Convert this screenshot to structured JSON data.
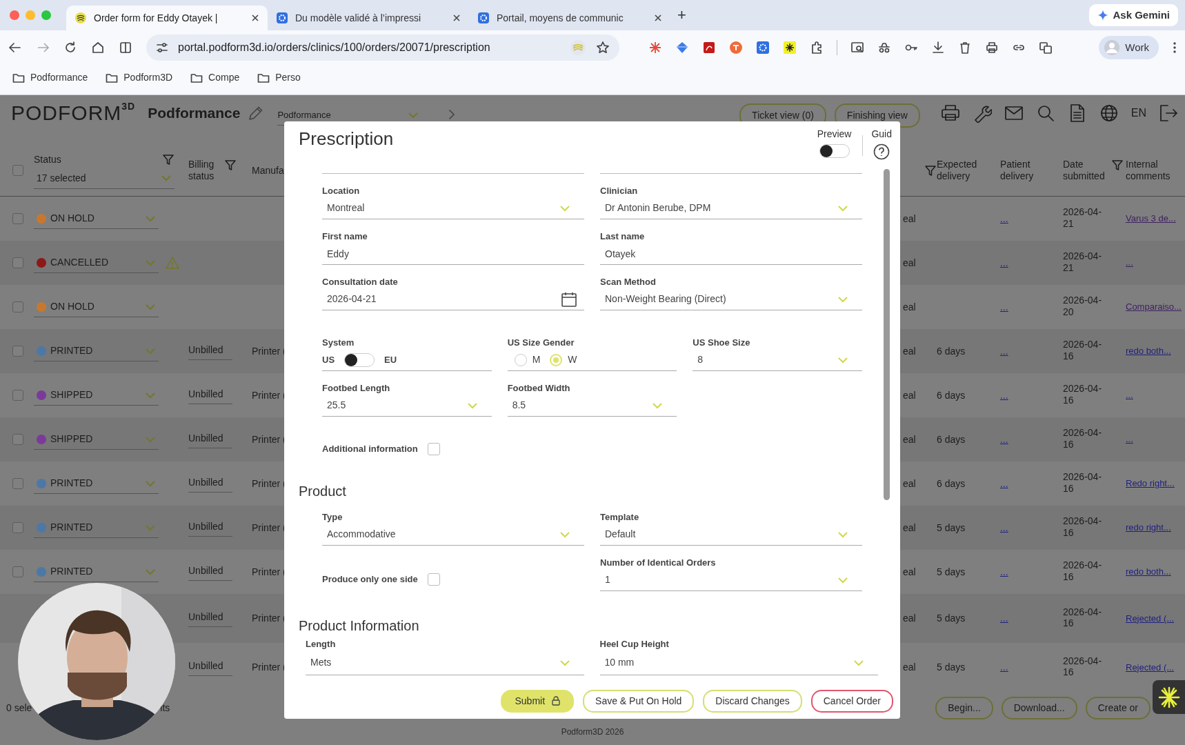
{
  "browser": {
    "tabs": [
      {
        "title": "Order form for Eddy Otayek |",
        "selected": true
      },
      {
        "title": "Du modèle validé à l’impressi",
        "selected": false
      },
      {
        "title": "Portail, moyens de communic",
        "selected": false
      }
    ],
    "new_tab": "+",
    "gemini": "Ask Gemini",
    "url": "portal.podform3d.io/orders/clinics/100/orders/20071/prescription",
    "profile": "Work",
    "bookmarks": [
      "Podformance",
      "Podform3D",
      "Compe",
      "Perso"
    ]
  },
  "app": {
    "logo": "PODFORM",
    "logo_sup": "3D",
    "clinic": "Podformance",
    "selector": "Podformance",
    "views": [
      "Ticket view (0)",
      "Finishing view"
    ],
    "language": "EN"
  },
  "table": {
    "all_checked": false,
    "status_filter": "17 selected",
    "columns": [
      {
        "label": "Status",
        "filter": true
      },
      {
        "label": "Billing status",
        "filter": true
      },
      {
        "label": "Manufa",
        "filter": false
      },
      {
        "filter": true
      },
      {
        "label": "Expected delivery",
        "filter": false
      },
      {
        "label": "Patient delivery",
        "filter": false
      },
      {
        "label": "Date submitted",
        "filter": true
      },
      {
        "label": "Internal comments",
        "filter": false
      }
    ],
    "rows": [
      {
        "checked": false,
        "status": "ON HOLD",
        "color": "#c8782e",
        "warning": false,
        "location": "eal",
        "patient": "...",
        "date": "2026-04-21",
        "comment": "Varus 3 de...",
        "visited": true
      },
      {
        "checked": false,
        "status": "CANCELLED",
        "color": "#8c1818",
        "warning": true,
        "location": "eal",
        "patient": "...",
        "date": "2026-04-21",
        "comment": "...",
        "visited": true
      },
      {
        "checked": false,
        "status": "ON HOLD",
        "color": "#c8782e",
        "warning": false,
        "location": "eal",
        "patient": "...",
        "date": "2026-04-20",
        "comment": "Comparaiso...",
        "visited": true
      },
      {
        "checked": false,
        "status": "PRINTED",
        "color": "#4b78a8",
        "warning": false,
        "billing": "Unbilled",
        "manufacturer": "Printer (",
        "location": "eal",
        "expected": "6 days",
        "patient": "...",
        "date": "2026-04-16",
        "comment": "redo both...",
        "visited": false
      },
      {
        "checked": false,
        "status": "SHIPPED",
        "color": "#7b3a9a",
        "warning": false,
        "billing": "Unbilled",
        "manufacturer": "Printer (",
        "location": "eal",
        "expected": "6 days",
        "patient": "...",
        "date": "2026-04-16",
        "comment": "...",
        "visited": false
      },
      {
        "checked": false,
        "status": "SHIPPED",
        "color": "#7b3a9a",
        "warning": false,
        "billing": "Unbilled",
        "manufacturer": "Printer (",
        "location": "eal",
        "expected": "6 days",
        "patient": "...",
        "date": "2026-04-16",
        "comment": "...",
        "visited": false
      },
      {
        "checked": false,
        "status": "PRINTED",
        "color": "#4b78a8",
        "warning": false,
        "billing": "Unbilled",
        "manufacturer": "Printer (",
        "location": "eal",
        "expected": "6 days",
        "patient": "...",
        "date": "2026-04-16",
        "comment": "Redo right...",
        "visited": false
      },
      {
        "checked": false,
        "status": "PRINTED",
        "color": "#4b78a8",
        "warning": false,
        "billing": "Unbilled",
        "manufacturer": "Printer (",
        "location": "eal",
        "expected": "5 days",
        "patient": "...",
        "date": "2026-04-16",
        "comment": "redo right...",
        "visited": false
      },
      {
        "checked": false,
        "status": "PRINTED",
        "color": "#4b78a8",
        "warning": false,
        "billing": "Unbilled",
        "manufacturer": "Printer (",
        "location": "eal",
        "expected": "5 days",
        "patient": "...",
        "date": "2026-04-16",
        "comment": "redo both...",
        "visited": false
      },
      {
        "billing": "Unbilled",
        "manufacturer": "Printer (",
        "location": "eal",
        "expected": "5 days",
        "patient": "...",
        "date": "2026-04-16",
        "comment": "Rejected (...",
        "visited": false
      },
      {
        "billing": "Unbilled",
        "manufacturer": "Printer (",
        "location": "eal",
        "expected": "5 days",
        "patient": "...",
        "date": "2026-04-16",
        "comment": "Rejected (...",
        "visited": false
      }
    ]
  },
  "footer": {
    "selection": "0 sele",
    "results": "lts",
    "actions": [
      "Begin...",
      "Download...",
      "Create or"
    ],
    "copyright": "Podform3D 2026"
  },
  "modal": {
    "title": "Prescription",
    "preview_label": "Preview",
    "preview_on": false,
    "guide_label": "Guid",
    "sections": [
      {
        "rows": [
          {
            "fields": [
              {
                "kind": "select",
                "label": "Location",
                "value": "Montreal"
              },
              {
                "kind": "select",
                "label": "Clinician",
                "value": "Dr Antonin Berube, DPM"
              }
            ]
          },
          {
            "fields": [
              {
                "kind": "text",
                "label": "First name",
                "value": "Eddy"
              },
              {
                "kind": "text",
                "label": "Last name",
                "value": "Otayek"
              }
            ]
          },
          {
            "fields": [
              {
                "kind": "date",
                "label": "Consultation date",
                "value": "2026-04-21"
              },
              {
                "kind": "select",
                "label": "Scan Method",
                "value": "Non-Weight Bearing (Direct)"
              }
            ]
          },
          {
            "fields": [
              {
                "kind": "toggle",
                "label": "System",
                "off_label": "US",
                "on_label": "EU",
                "on": false
              },
              {
                "kind": "radio",
                "label": "US Size Gender",
                "options": [
                  {
                    "label": "M",
                    "selected": false
                  },
                  {
                    "label": "W",
                    "selected": true
                  }
                ]
              },
              {
                "kind": "select",
                "label": "US Shoe Size",
                "value": "8"
              },
              {
                "kind": "select",
                "label": "Footbed Length",
                "value": "25.5"
              },
              {
                "kind": "select",
                "label": "Footbed Width",
                "value": "8.5"
              }
            ]
          },
          {
            "fields": [
              {
                "kind": "checkbox",
                "label": "Additional information",
                "checked": false
              }
            ]
          }
        ]
      },
      {
        "title": "Product",
        "rows": [
          {
            "fields": [
              {
                "kind": "select",
                "label": "Type",
                "value": "Accommodative"
              },
              {
                "kind": "select",
                "label": "Template",
                "value": "Default"
              }
            ]
          },
          {
            "fields": [
              {
                "kind": "checkbox",
                "label": "Produce only one side",
                "checked": false
              },
              {
                "kind": "select",
                "label": "Number of Identical Orders",
                "value": "1"
              }
            ]
          }
        ]
      },
      {
        "title": "Product Information",
        "rows": [
          {
            "fields": [
              {
                "kind": "select",
                "label": "Length",
                "value": "Mets"
              },
              {
                "kind": "select",
                "label": "Heel Cup Height",
                "value": "10 mm"
              }
            ]
          }
        ]
      }
    ],
    "buttons": [
      {
        "label": "Submit",
        "kind": "primary",
        "locked": true
      },
      {
        "label": "Save & Put On Hold",
        "kind": "outline",
        "locked": false
      },
      {
        "label": "Discard Changes",
        "kind": "outline",
        "locked": false
      },
      {
        "label": "Cancel Order",
        "kind": "danger",
        "locked": false
      }
    ]
  }
}
